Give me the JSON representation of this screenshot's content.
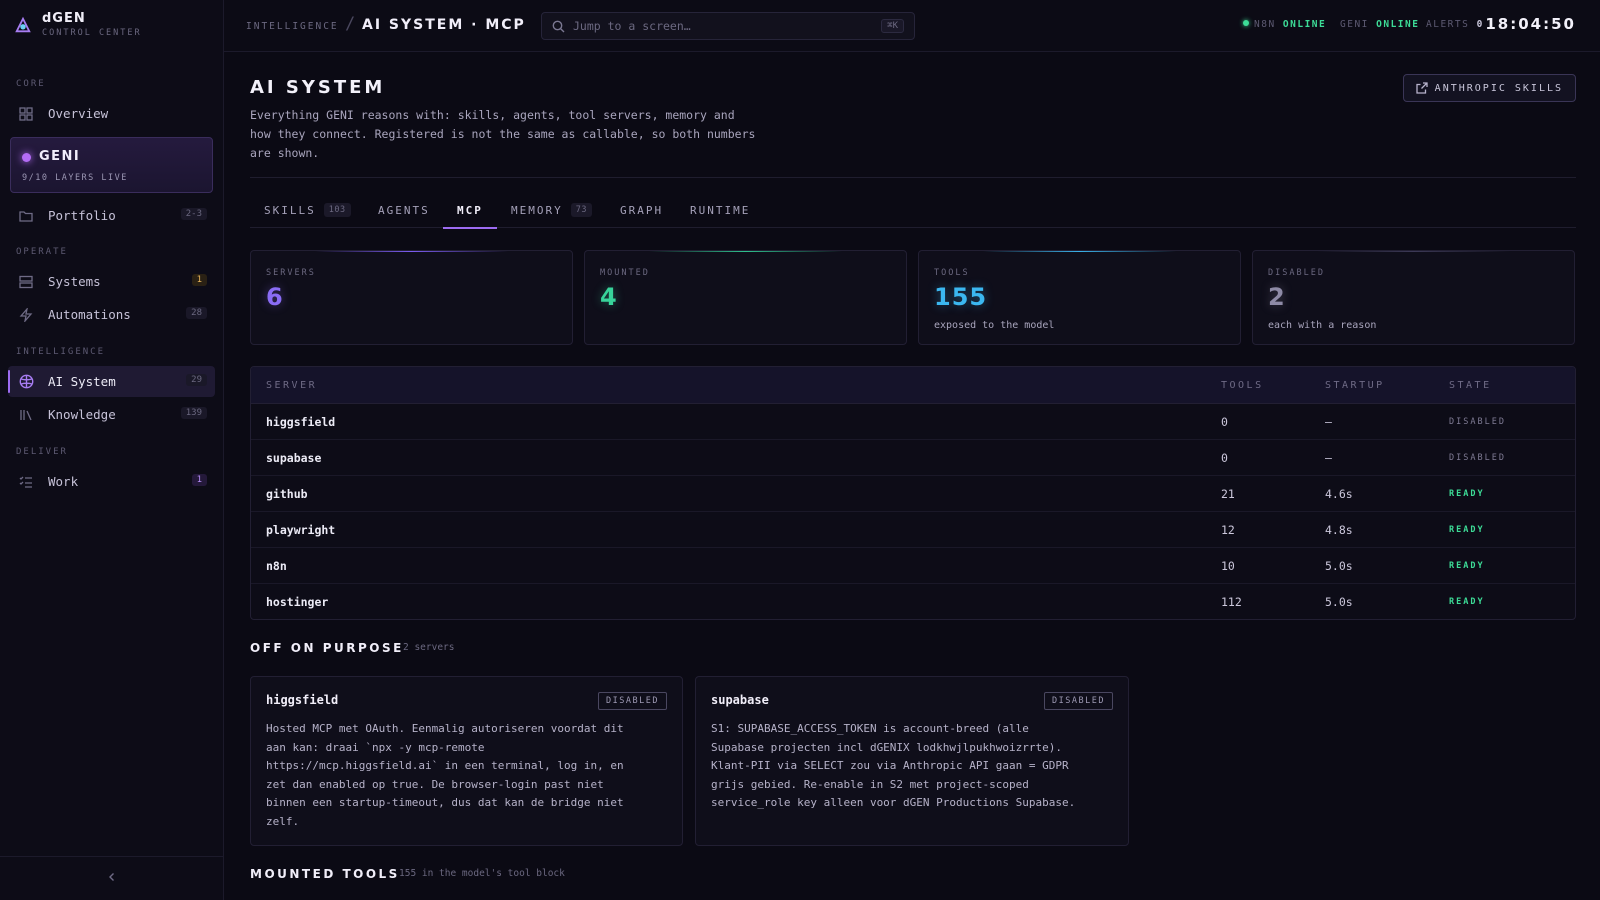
{
  "brand": {
    "name": "dGEN",
    "subtitle": "CONTROL CENTER"
  },
  "sidebar": {
    "sections": {
      "core": "CORE",
      "operate": "OPERATE",
      "intelligence": "INTELLIGENCE",
      "deliver": "DELIVER"
    },
    "overview": {
      "label": "Overview"
    },
    "geni": {
      "name": "GENI",
      "status": "9/10 LAYERS LIVE"
    },
    "portfolio": {
      "label": "Portfolio",
      "badge": "2-3"
    },
    "systems": {
      "label": "Systems",
      "badge": "1"
    },
    "automations": {
      "label": "Automations",
      "badge": "28"
    },
    "ai_system": {
      "label": "AI System",
      "badge": "29"
    },
    "knowledge": {
      "label": "Knowledge",
      "badge": "139"
    },
    "work": {
      "label": "Work",
      "badge": "1"
    }
  },
  "topbar": {
    "breadcrumb_parent": "INTELLIGENCE",
    "breadcrumb_sep": "/",
    "breadcrumb_current": "AI SYSTEM · MCP",
    "search_placeholder": "Jump to a screen…",
    "search_shortcut": "⌘K",
    "status": {
      "n8n_label": "N8N",
      "n8n_value": "ONLINE",
      "geni_label": "GENI",
      "geni_value": "ONLINE",
      "alerts_label": "ALERTS",
      "alerts_value": "0"
    },
    "clock": "18:04:50"
  },
  "page": {
    "title": "AI SYSTEM",
    "description": "Everything GENI reasons with: skills, agents, tool servers, memory and how they connect. Registered is not the same as callable, so both numbers are shown.",
    "action_button": "ANTHROPIC SKILLS"
  },
  "tabs": [
    {
      "label": "SKILLS",
      "count": "103"
    },
    {
      "label": "AGENTS",
      "count": ""
    },
    {
      "label": "MCP",
      "count": ""
    },
    {
      "label": "MEMORY",
      "count": "73"
    },
    {
      "label": "GRAPH",
      "count": ""
    },
    {
      "label": "RUNTIME",
      "count": ""
    }
  ],
  "stats": [
    {
      "label": "SERVERS",
      "value": "6",
      "sub": "",
      "color": "#8a6cf5"
    },
    {
      "label": "MOUNTED",
      "value": "4",
      "sub": "",
      "color": "#38d39a"
    },
    {
      "label": "TOOLS",
      "value": "155",
      "sub": "exposed to the model",
      "color": "#3bb7f0"
    },
    {
      "label": "DISABLED",
      "value": "2",
      "sub": "each with a reason",
      "color": "#8e8aa6"
    }
  ],
  "table": {
    "headers": {
      "server": "SERVER",
      "tools": "TOOLS",
      "startup": "STARTUP",
      "state": "STATE"
    },
    "rows": [
      {
        "server": "higgsfield",
        "tools": "0",
        "startup": "—",
        "state": "DISABLED"
      },
      {
        "server": "supabase",
        "tools": "0",
        "startup": "—",
        "state": "DISABLED"
      },
      {
        "server": "github",
        "tools": "21",
        "startup": "4.6s",
        "state": "READY"
      },
      {
        "server": "playwright",
        "tools": "12",
        "startup": "4.8s",
        "state": "READY"
      },
      {
        "server": "n8n",
        "tools": "10",
        "startup": "5.0s",
        "state": "READY"
      },
      {
        "server": "hostinger",
        "tools": "112",
        "startup": "5.0s",
        "state": "READY"
      }
    ]
  },
  "off_on_purpose": {
    "title": "OFF ON PURPOSE",
    "subtitle": "2 servers",
    "cards": [
      {
        "name": "higgsfield",
        "badge": "DISABLED",
        "body": "Hosted MCP met OAuth. Eenmalig autoriseren voordat dit\naan kan: draai `npx -y mcp-remote\nhttps://mcp.higgsfield.ai` in een terminal, log in, en\nzet dan enabled op true. De browser-login past niet\nbinnen een startup-timeout, dus dat kan de bridge niet\nzelf."
      },
      {
        "name": "supabase",
        "badge": "DISABLED",
        "body": "S1: SUPABASE_ACCESS_TOKEN is account-breed (alle\nSupabase projecten incl dGENIX lodkhwjlpukhwoizrrte).\nKlant-PII via SELECT zou via Anthropic API gaan = GDPR\ngrijs gebied. Re-enable in S2 met project-scoped\nservice_role key alleen voor dGEN Productions Supabase."
      }
    ]
  },
  "mounted_tools": {
    "title": "MOUNTED TOOLS",
    "subtitle": "155 in the model's tool block"
  }
}
